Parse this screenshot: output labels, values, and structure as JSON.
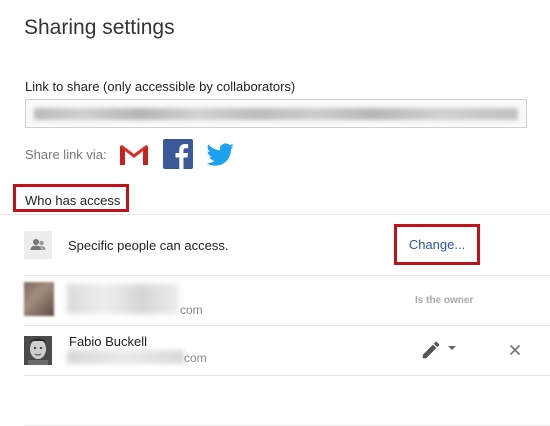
{
  "dialog": {
    "title": "Sharing settings",
    "link_label": "Link to share (only accessible by collaborators)",
    "share_via_label": "Share link via:",
    "share_icons": [
      "gmail-icon",
      "facebook-icon",
      "twitter-icon"
    ],
    "accent_color": "#c0121b",
    "link_color": "#2b55a5"
  },
  "access": {
    "heading": "Who has access",
    "summary_text": "Specific people can access.",
    "change_label": "Change..."
  },
  "people": [
    {
      "email_suffix": "com",
      "role": "Is the owner"
    },
    {
      "name": "Fabio Buckell",
      "email_suffix": "com"
    }
  ]
}
